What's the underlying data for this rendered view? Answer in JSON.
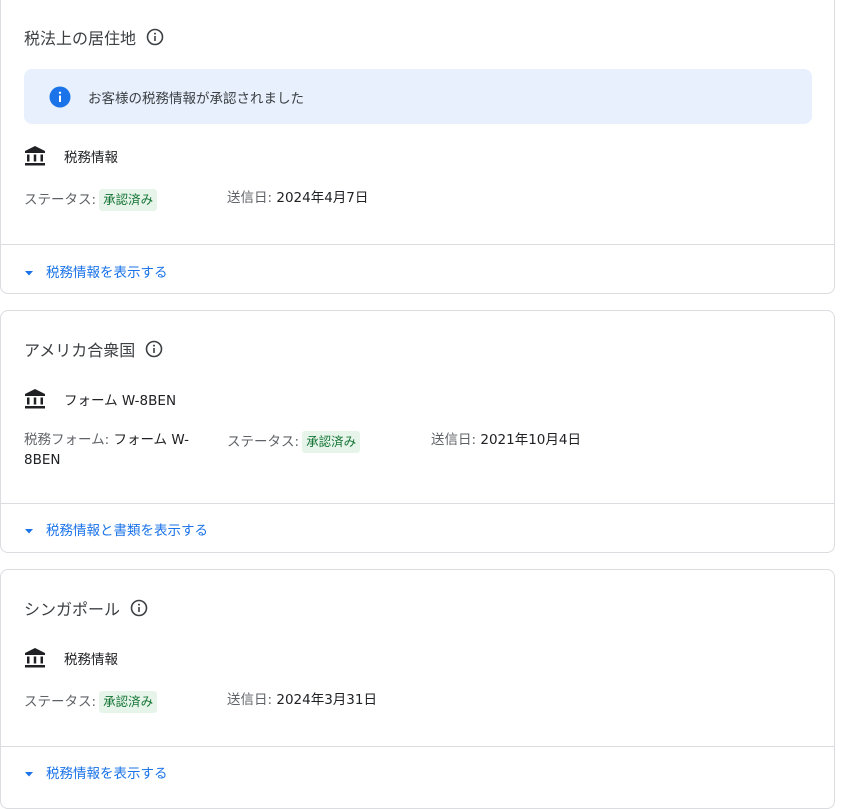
{
  "cards": [
    {
      "title": "税法上の居住地",
      "banner": "お客様の税務情報が承認されました",
      "item": "税務情報",
      "status_label": "ステータス:",
      "status_value": "承認済み",
      "sent_label": "送信日:",
      "sent_value": "2024年4月7日",
      "expand": "税務情報を表示する"
    },
    {
      "title": "アメリカ合衆国",
      "item": "フォーム W-8BEN",
      "form_label": "税務フォーム:",
      "form_value_line1": "フォーム W-",
      "form_value_line2": "8BEN",
      "status_label": "ステータス:",
      "status_value": "承認済み",
      "sent_label": "送信日:",
      "sent_value": "2021年10月4日",
      "expand": "税務情報と書類を表示する"
    },
    {
      "title": "シンガポール",
      "item": "税務情報",
      "status_label": "ステータス:",
      "status_value": "承認済み",
      "sent_label": "送信日:",
      "sent_value": "2024年3月31日",
      "expand": "税務情報を表示する"
    }
  ],
  "icons": {
    "info": "info-outline-icon",
    "banner_info": "info-filled-icon",
    "bank": "bank-icon",
    "caret": "caret-down-icon"
  },
  "colors": {
    "accent": "#1a73e8",
    "banner_bg": "#e8f0fe",
    "badge_bg": "#e6f4ea",
    "badge_text": "#137333"
  }
}
